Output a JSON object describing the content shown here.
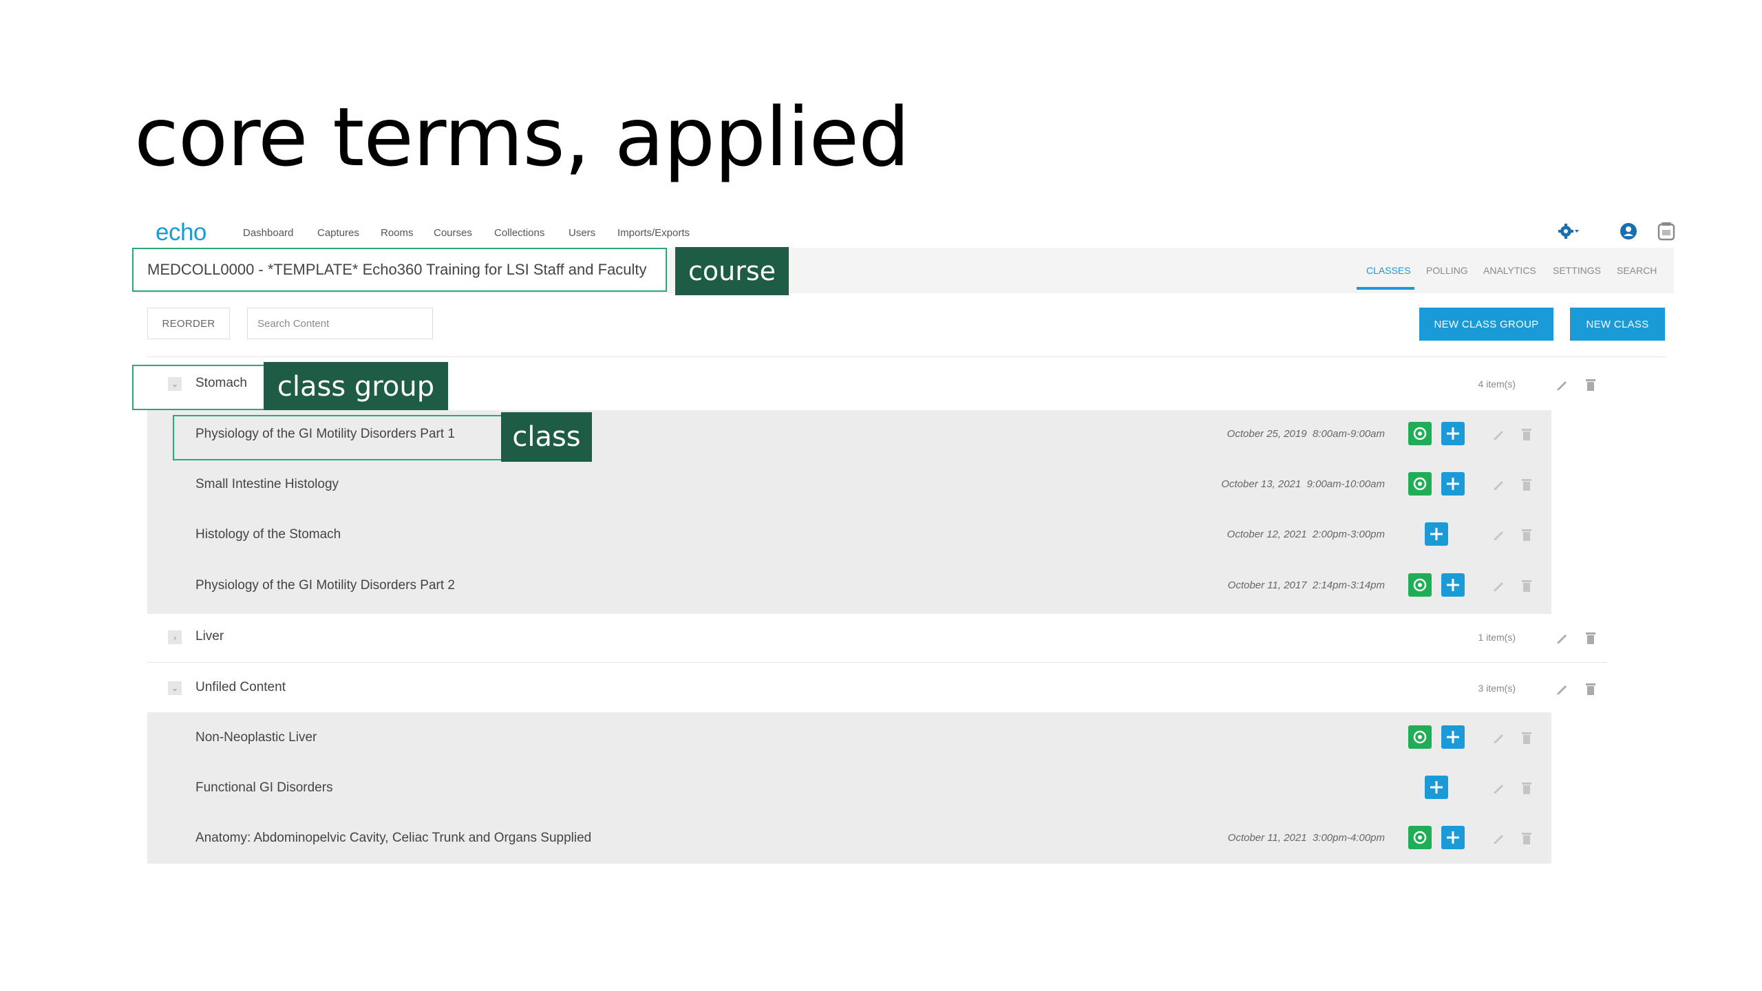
{
  "slide": {
    "title": "core terms, applied"
  },
  "app": {
    "logo": "echo",
    "nav": [
      "Dashboard",
      "Captures",
      "Rooms",
      "Courses",
      "Collections",
      "Users",
      "Imports/Exports"
    ],
    "icons": [
      "gear-icon",
      "user-icon",
      "help-icon"
    ]
  },
  "course": {
    "title": "MEDCOLL0000 - *TEMPLATE* Echo360 Training for LSI Staff and Faculty",
    "tabs": [
      "CLASSES",
      "POLLING",
      "ANALYTICS",
      "SETTINGS",
      "SEARCH"
    ],
    "active_tab": "CLASSES"
  },
  "toolbar": {
    "reorder": "REORDER",
    "search_placeholder": "Search Content",
    "new_class_group": "NEW CLASS GROUP",
    "new_class": "NEW CLASS"
  },
  "callouts": {
    "course": "course",
    "class_group": "class group",
    "class": "class"
  },
  "groups": [
    {
      "name": "Stomach",
      "count": "4 item(s)",
      "expanded": true,
      "classes": [
        {
          "title": "Physiology of the GI Motility Disorders Part 1",
          "date": "October 25, 2019",
          "time": "8:00am-9:00am"
        },
        {
          "title": "Small Intestine Histology",
          "date": "October 13, 2021",
          "time": "9:00am-10:00am"
        },
        {
          "title": "Histology of the Stomach",
          "date": "October 12, 2021",
          "time": "2:00pm-3:00pm"
        },
        {
          "title": "Physiology of the GI Motility Disorders Part 2",
          "date": "October 11, 2017",
          "time": "2:14pm-3:14pm"
        }
      ]
    },
    {
      "name": "Liver",
      "count": "1 item(s)",
      "expanded": false,
      "classes": []
    },
    {
      "name": "Unfiled Content",
      "count": "3 item(s)",
      "expanded": true,
      "classes": [
        {
          "title": "Non-Neoplastic Liver",
          "date": "",
          "time": ""
        },
        {
          "title": "Functional GI Disorders",
          "date": "",
          "time": ""
        },
        {
          "title": "Anatomy: Abdominopelvic Cavity, Celiac Trunk and Organs Supplied",
          "date": "October 11, 2021",
          "time": "3:00pm-4:00pm"
        }
      ]
    }
  ],
  "colors": {
    "accent": "#1a9ad6",
    "callout": "#1f5c45",
    "highlight": "#2aa876",
    "capture": "#1fae55"
  }
}
